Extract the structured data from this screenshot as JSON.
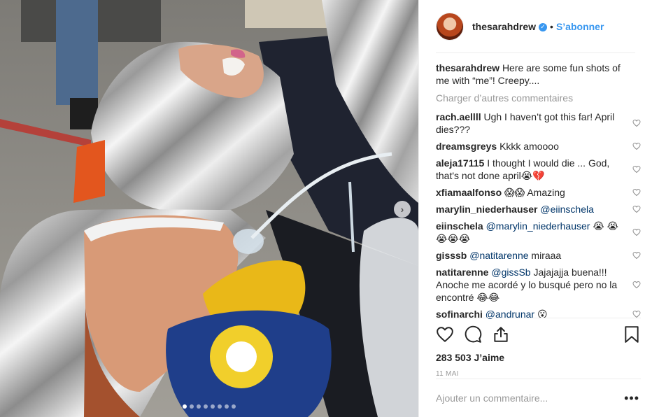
{
  "post": {
    "photo_alt": "photo",
    "carousel": {
      "count": 8,
      "active_index": 0,
      "next_arrow": "›"
    }
  },
  "header": {
    "username": "thesarahdrew",
    "verified_icon": "verified-badge-icon",
    "separator": "•",
    "follow_label": "S’abonner"
  },
  "caption": {
    "username": "thesarahdrew",
    "text": "Here are some fun shots of me with “me”! Creepy...."
  },
  "load_more_label": "Charger d’autres commentaires",
  "comments": [
    {
      "user": "rach.aellll",
      "mention": "",
      "text": "Ugh I haven’t got this far! April dies???"
    },
    {
      "user": "dreamsgreys",
      "mention": "",
      "text": "Kkkk amoooo"
    },
    {
      "user": "aleja17115",
      "mention": "",
      "text": "I thought I would die ... God, that's not done april😭💔"
    },
    {
      "user": "xfiamaalfonso",
      "mention": "",
      "text": "😱😱 Amazing"
    },
    {
      "user": "marylin_niederhauser",
      "mention": "@eiinschela",
      "text": ""
    },
    {
      "user": "eiinschela",
      "mention": "@marylin_niederhauser",
      "text": "😭 😭😭😭😭"
    },
    {
      "user": "gisssb",
      "mention": "@natitarenne",
      "text": "miraaa"
    },
    {
      "user": "natitarenne",
      "mention": "@gissSb",
      "text": "Jajajajja buena!!! Anoche me acordé y lo busqué pero no la encontré 😂😂"
    },
    {
      "user": "sofinarchi",
      "mention": "@andrunar",
      "text": "😮"
    }
  ],
  "actions": {
    "like_icon": "heart-icon",
    "comment_icon": "comment-icon",
    "share_icon": "share-icon",
    "save_icon": "bookmark-icon"
  },
  "likes": {
    "count": "283 503",
    "label": "J’aime"
  },
  "date": "11 MAI",
  "add_comment": {
    "placeholder": "Ajouter un commentaire...",
    "more": "•••"
  },
  "colors": {
    "accent": "#3897f0",
    "text": "#262626",
    "muted": "#999999",
    "border": "#efefef"
  }
}
